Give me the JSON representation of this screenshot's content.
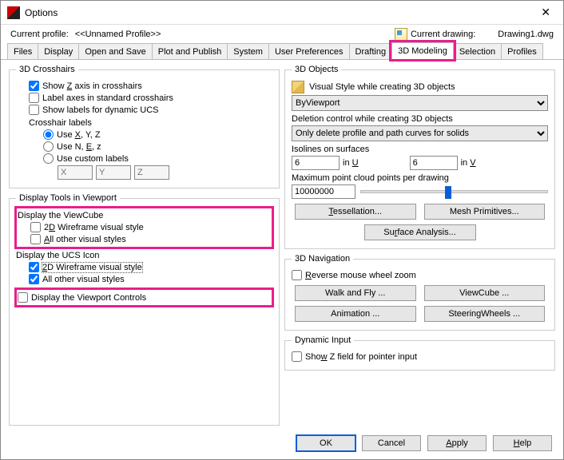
{
  "window": {
    "title": "Options"
  },
  "header": {
    "profile_label": "Current profile:",
    "profile_value": "<<Unnamed Profile>>",
    "drawing_label": "Current drawing:",
    "drawing_value": "Drawing1.dwg"
  },
  "tabs": [
    "Files",
    "Display",
    "Open and Save",
    "Plot and Publish",
    "System",
    "User Preferences",
    "Drafting",
    "3D Modeling",
    "Selection",
    "Profiles"
  ],
  "active_tab": "3D Modeling",
  "crosshairs": {
    "legend": "3D Crosshairs",
    "show_z": "Show Z axis in crosshairs",
    "label_axes": "Label axes in standard crosshairs",
    "show_labels_ucs": "Show labels for dynamic UCS",
    "crosshair_labels": "Crosshair labels",
    "use_xyz": "Use X, Y, Z",
    "use_nez": "Use N, E, z",
    "use_custom": "Use custom labels",
    "x_ph": "X",
    "y_ph": "Y",
    "z_ph": "Z"
  },
  "viewport": {
    "legend": "Display Tools in Viewport",
    "display_viewcube": "Display the ViewCube",
    "vc_2d": "2D Wireframe visual style",
    "vc_other": "All other visual styles",
    "display_ucs": "Display the UCS Icon",
    "ucs_2d": "2D Wireframe visual style",
    "ucs_other": "All other visual styles",
    "display_vp_controls": "Display the Viewport Controls"
  },
  "objects": {
    "legend": "3D Objects",
    "visual_style_lbl": "Visual Style while creating 3D objects",
    "visual_style_val": "ByViewport",
    "deletion_lbl": "Deletion control while creating 3D objects",
    "deletion_val": "Only delete profile and path curves for solids",
    "isolines_lbl": "Isolines on surfaces",
    "iso_u_val": "6",
    "iso_u_lbl": "in U",
    "iso_v_val": "6",
    "iso_v_lbl": "in V",
    "pointcloud_lbl": "Maximum point cloud points per drawing",
    "pointcloud_val": "10000000",
    "btn_tess": "Tessellation...",
    "btn_mesh": "Mesh Primitives...",
    "btn_surf": "Surface Analysis..."
  },
  "nav": {
    "legend": "3D Navigation",
    "reverse": "Reverse mouse wheel zoom",
    "btn_walk": "Walk and Fly ...",
    "btn_viewcube": "ViewCube ...",
    "btn_anim": "Animation ...",
    "btn_steer": "SteeringWheels ..."
  },
  "dyn": {
    "legend": "Dynamic Input",
    "show_z": "Show Z field for pointer input"
  },
  "footer": {
    "ok": "OK",
    "cancel": "Cancel",
    "apply": "Apply",
    "help": "Help"
  }
}
